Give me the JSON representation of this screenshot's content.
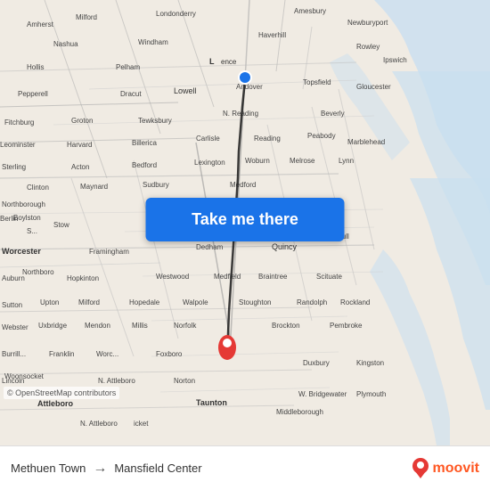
{
  "map": {
    "background_color": "#e8e0d8",
    "route_line_color": "#1a1a1a",
    "origin_color": "#1a73e8",
    "destination_color": "#e53935"
  },
  "button": {
    "label": "Take me there",
    "background": "#1a73e8"
  },
  "bottom_bar": {
    "origin": "Methuen Town",
    "destination": "Mansfield Center",
    "arrow": "→",
    "copyright": "© OpenStreetMap contributors",
    "moovit_text": "moovit"
  }
}
